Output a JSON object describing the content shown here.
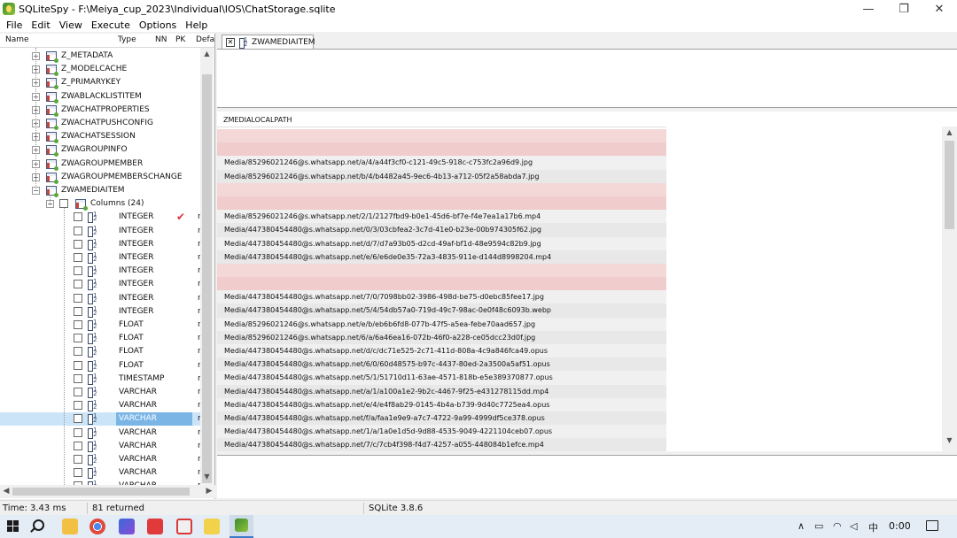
{
  "window": {
    "title": "SQLiteSpy - F:\\Meiya_cup_2023\\Individual\\IOS\\ChatStorage.sqlite",
    "minimize": "—",
    "restore": "❐",
    "close": "✕"
  },
  "menu": [
    "File",
    "Edit",
    "View",
    "Execute",
    "Options",
    "Help"
  ],
  "tree": {
    "headers": {
      "name": "Name",
      "type": "Type",
      "nn": "NN",
      "pk": "PK",
      "default": "Defa"
    },
    "tables": [
      "Z_METADATA",
      "Z_MODELCACHE",
      "Z_PRIMARYKEY",
      "ZWABLACKLISTITEM",
      "ZWACHATPROPERTIES",
      "ZWACHATPUSHCONFIG",
      "ZWACHATSESSION",
      "ZWAGROUPINFO",
      "ZWAGROUPMEMBER",
      "ZWAGROUPMEMBERSCHANGE",
      "ZWAMEDIAITEM"
    ],
    "columns_label": "Columns (24)",
    "column_types": [
      "INTEGER",
      "INTEGER",
      "INTEGER",
      "INTEGER",
      "INTEGER",
      "INTEGER",
      "INTEGER",
      "INTEGER",
      "FLOAT",
      "FLOAT",
      "FLOAT",
      "FLOAT",
      "TIMESTAMP",
      "VARCHAR",
      "VARCHAR",
      "VARCHAR",
      "VARCHAR",
      "VARCHAR",
      "VARCHAR",
      "VARCHAR",
      "VARCHAR"
    ],
    "selected_column_index": 15,
    "pk_check_index": 0,
    "plus": "+",
    "minus": "−"
  },
  "tab": {
    "label": "ZWAMEDIAITEM",
    "close": "✕"
  },
  "grid": {
    "column": "ZMEDIALOCALPATH",
    "rows": [
      "",
      "",
      "Media/85296021246@s.whatsapp.net/a/4/a44f3cf0-c121-49c5-918c-c753fc2a96d9.jpg",
      "Media/85296021246@s.whatsapp.net/b/4/b4482a45-9ec6-4b13-a712-05f2a58abda7.jpg",
      "",
      "",
      "Media/85296021246@s.whatsapp.net/2/1/2127fbd9-b0e1-45d6-bf7e-f4e7ea1a17b6.mp4",
      "Media/447380454480@s.whatsapp.net/0/3/03cbfea2-3c7d-41e0-b23e-00b974305f62.jpg",
      "Media/447380454480@s.whatsapp.net/d/7/d7a93b05-d2cd-49af-bf1d-48e9594c82b9.jpg",
      "Media/447380454480@s.whatsapp.net/e/6/e6de0e35-72a3-4835-911e-d144d8998204.mp4",
      "",
      "",
      "Media/447380454480@s.whatsapp.net/7/0/7098bb02-3986-498d-be75-d0ebc85fee17.jpg",
      "Media/447380454480@s.whatsapp.net/5/4/54db57a0-719d-49c7-98ac-0e0f48c6093b.webp",
      "Media/85296021246@s.whatsapp.net/e/b/eb6b6fd8-077b-47f5-a5ea-febe70aad657.jpg",
      "Media/85296021246@s.whatsapp.net/6/a/6a46ea16-072b-46f0-a228-ce05dcc23d0f.jpg",
      "Media/447380454480@s.whatsapp.net/d/c/dc71e525-2c71-411d-808a-4c9a846fca49.opus",
      "Media/447380454480@s.whatsapp.net/6/0/60d48575-b97c-4437-80ed-2a3500a5af51.opus",
      "Media/447380454480@s.whatsapp.net/5/1/51710d11-63ae-4571-818b-e5e389370877.opus",
      "Media/447380454480@s.whatsapp.net/a/1/a100a1e2-9b2c-4467-9f25-e431278115dd.mp4",
      "Media/447380454480@s.whatsapp.net/e/4/e4f8ab29-0145-4b4a-b739-9d40c7725ea4.opus",
      "Media/447380454480@s.whatsapp.net/f/a/faa1e9e9-a7c7-4722-9a99-4999df5ce378.opus",
      "Media/447380454480@s.whatsapp.net/1/a/1a0e1d5d-9d88-4535-9049-4221104ceb07.opus",
      "Media/447380454480@s.whatsapp.net/7/c/7cb4f398-f4d7-4257-a055-448084b1efce.mp4"
    ]
  },
  "status": {
    "time": "Time: 3.43 ms",
    "returned": "81 returned",
    "version": "SQLite 3.8.6"
  },
  "taskbar": {
    "ime": "中",
    "clock": "0:00",
    "tray_up": "∧"
  },
  "colors": {
    "empty_row": "#f4d7d7",
    "selection": "#7ab5e6",
    "check": "#e03040"
  }
}
